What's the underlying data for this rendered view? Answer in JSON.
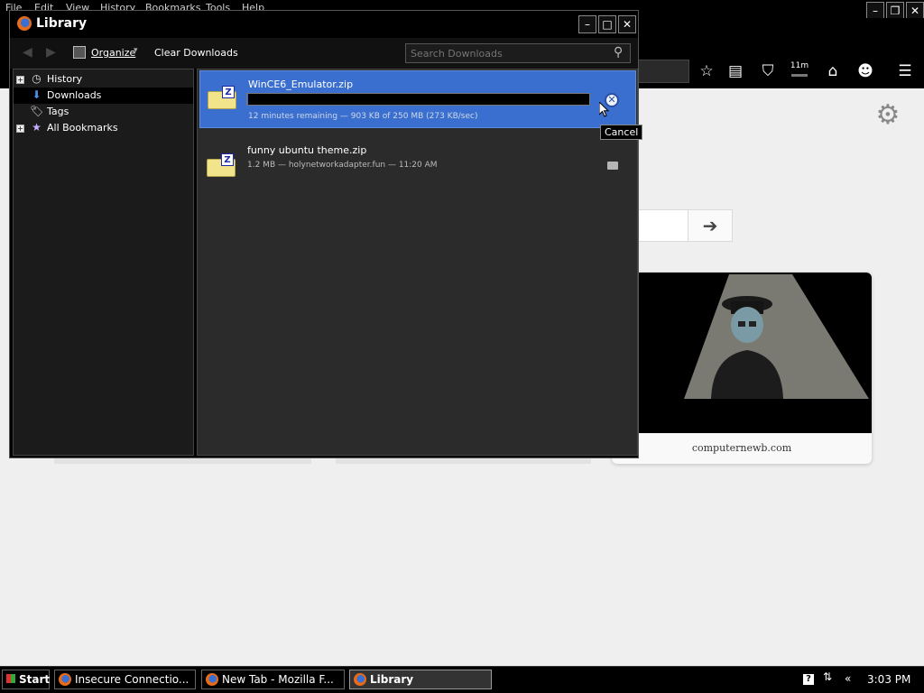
{
  "background_window": {
    "menus": [
      "File",
      "Edit",
      "View",
      "History",
      "Bookmarks",
      "Tools",
      "Help"
    ],
    "toolbar_time_badge": "11m",
    "top_site_label": "computernewb.com"
  },
  "library": {
    "title": "Library",
    "toolbar": {
      "organize_label": "Organize",
      "clear_downloads_label": "Clear Downloads",
      "search_placeholder": "Search Downloads"
    },
    "sidebar": {
      "items": [
        {
          "label": "History",
          "icon": "clock-icon",
          "expandable": true
        },
        {
          "label": "Downloads",
          "icon": "download-arrow-icon",
          "expandable": false,
          "selected": true
        },
        {
          "label": "Tags",
          "icon": "tag-icon",
          "expandable": false
        },
        {
          "label": "All Bookmarks",
          "icon": "star-folder-icon",
          "expandable": true
        }
      ]
    },
    "downloads": [
      {
        "name": "WinCE6_Emulator.zip",
        "status": "12 minutes remaining — 903 KB of 250 MB (273 KB/sec)",
        "progress": 0.0035,
        "selected": true,
        "action": "cancel"
      },
      {
        "name": "funny ubuntu theme.zip",
        "status": "1.2 MB — holynetworkadapter.fun — 11:20 AM",
        "selected": false,
        "action": "open-folder"
      }
    ],
    "tooltip": "Cancel"
  },
  "taskbar": {
    "start_label": "Start",
    "tasks": [
      {
        "label": "Insecure Connectio...",
        "active": false
      },
      {
        "label": "New Tab - Mozilla F...",
        "active": false
      },
      {
        "label": "Library",
        "active": true
      }
    ],
    "clock": "3:03 PM"
  },
  "colors": {
    "selection_blue": "#3a6fd0",
    "panel_dark": "#2b2b2b",
    "window_black": "#000000"
  }
}
